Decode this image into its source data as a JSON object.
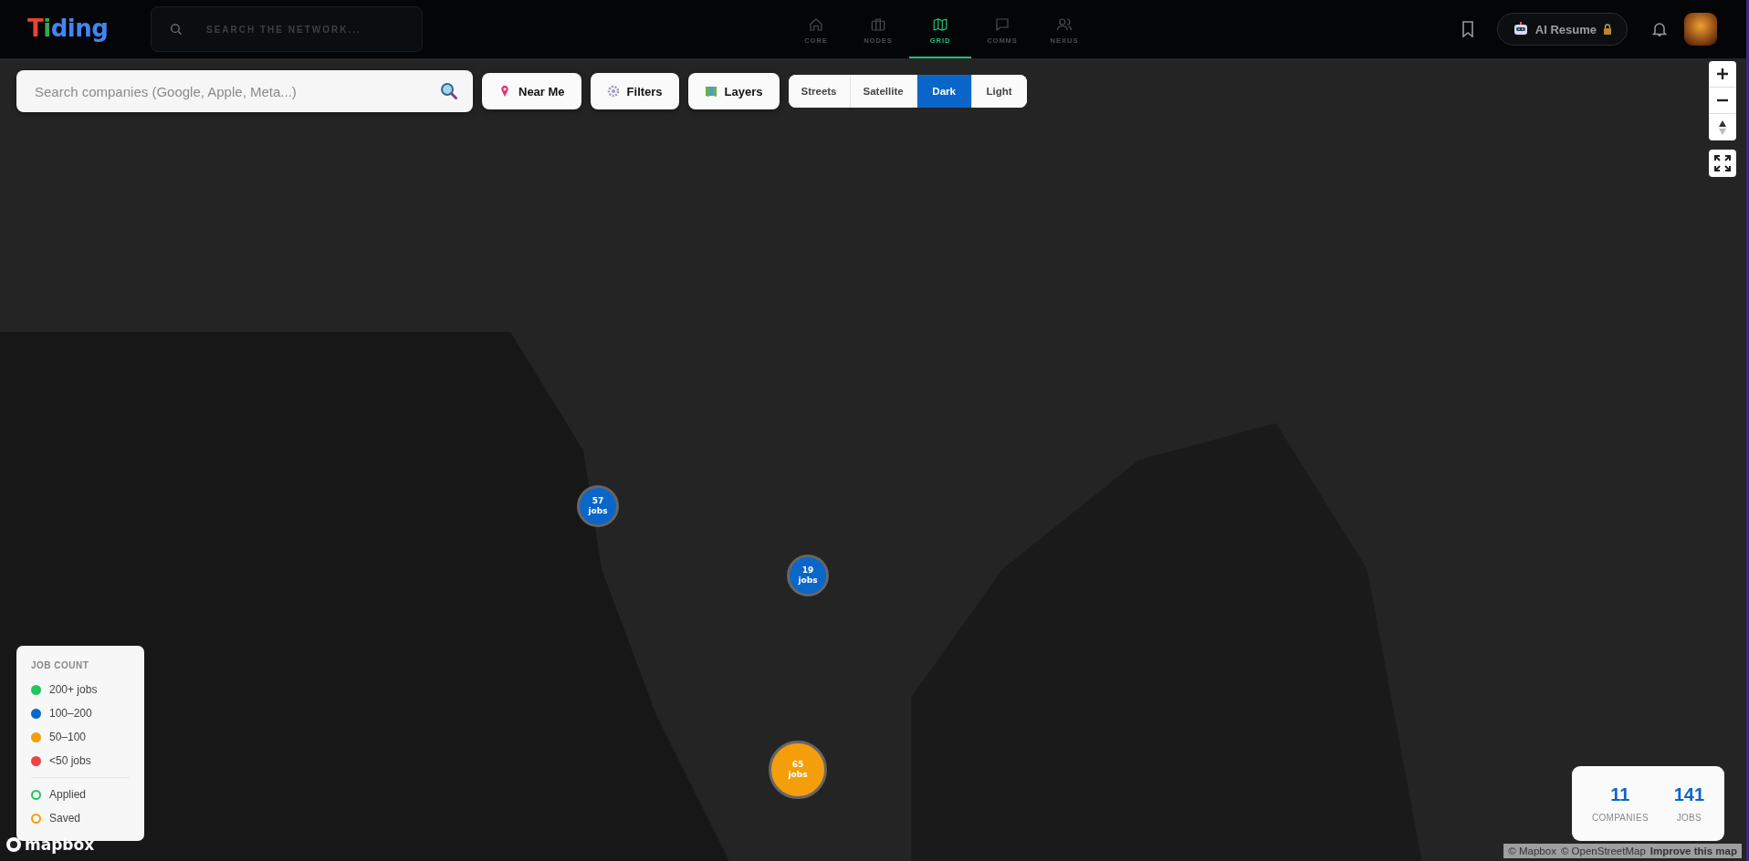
{
  "topbar": {
    "logo": [
      {
        "char": "T",
        "color": "#ea4335"
      },
      {
        "char": "i",
        "color": "#34a853"
      },
      {
        "char": "d",
        "color": "#4285f4"
      },
      {
        "char": "i",
        "color": "#4285f4"
      },
      {
        "char": "n",
        "color": "#4285f4"
      },
      {
        "char": "g",
        "color": "#4285f4"
      }
    ],
    "search": {
      "placeholder": "SEARCH THE NETWORK..."
    },
    "nav": [
      {
        "label": "CORE",
        "selected": false
      },
      {
        "label": "NODES",
        "selected": false
      },
      {
        "label": "GRID",
        "selected": true
      },
      {
        "label": "COMMS",
        "selected": false
      },
      {
        "label": "NEXUS",
        "selected": false
      }
    ],
    "ai_resume": {
      "label": "AI Resume",
      "locked": true
    }
  },
  "map_toolbar": {
    "search": {
      "placeholder": "Search companies (Google, Apple, Meta...)"
    },
    "buttons": [
      {
        "label": "Near Me"
      },
      {
        "label": "Filters"
      },
      {
        "label": "Layers"
      }
    ],
    "styles": [
      {
        "label": "Streets",
        "selected": false
      },
      {
        "label": "Satellite",
        "selected": false
      },
      {
        "label": "Dark",
        "selected": true
      },
      {
        "label": "Light",
        "selected": false
      }
    ]
  },
  "clusters": [
    {
      "count": "57",
      "unit": "jobs",
      "color": "#0b66c9"
    },
    {
      "count": "19",
      "unit": "jobs",
      "color": "#0b66c9"
    },
    {
      "count": "65",
      "unit": "jobs",
      "color": "#f59e0b"
    }
  ],
  "legend": {
    "title": "JOB COUNT",
    "items": [
      {
        "label": "200+ jobs",
        "kind": "dot",
        "color": "#22c55e"
      },
      {
        "label": "100–200",
        "kind": "dot",
        "color": "#0b66c9"
      },
      {
        "label": "50–100",
        "kind": "dot",
        "color": "#f59e0b"
      },
      {
        "label": "<50 jobs",
        "kind": "dot",
        "color": "#ef4444"
      },
      {
        "label": "Applied",
        "kind": "ring",
        "color": "#22c55e"
      },
      {
        "label": "Saved",
        "kind": "ring",
        "color": "#f59e0b"
      }
    ]
  },
  "stats": [
    {
      "value": "11",
      "label": "COMPANIES"
    },
    {
      "value": "141",
      "label": "JOBS"
    }
  ],
  "attribution": {
    "logo": "mapbox",
    "links": [
      "© Mapbox",
      "© OpenStreetMap"
    ],
    "improve": "Improve this map"
  }
}
